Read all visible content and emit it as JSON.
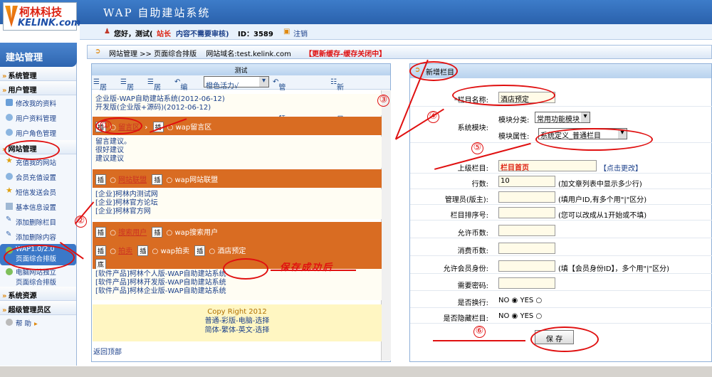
{
  "app": {
    "logo_line1": "柯林科技",
    "logo_line2": "KELINK.com",
    "system_title": "WAP 自助建站系统"
  },
  "user": {
    "greeting": "您好，测试(",
    "role": "站长",
    "notice": "内容不需要审核)",
    "id_label": "ID：3589",
    "logout": "注销"
  },
  "nav": {
    "header": "建站管理",
    "sections": [
      {
        "label": "系统管理"
      },
      {
        "label": "用户管理",
        "items": [
          "修改我的资料",
          "用户资料管理",
          "用户角色管理"
        ]
      },
      {
        "label": "网站管理",
        "items": [
          "充值我的网站",
          "会员充值设置",
          "短信发送会员",
          "基本信息设置",
          "添加删除栏目",
          "添加删除内容",
          "WAP1.0/2.0",
          "页面综合排版",
          "电脑网站独立",
          "页面综合排版"
        ]
      },
      {
        "label": "系统资源"
      },
      {
        "label": "超级管理员区"
      }
    ],
    "help": "帮 助"
  },
  "crumb": {
    "path": "网站管理 >> 页面综合排版",
    "domain_label": "网站域名:test.kelink.com",
    "status": "【更新缓存-缓存关闭中】"
  },
  "left": {
    "title": "测试",
    "toolbar": {
      "left": "居左",
      "center": "居中",
      "right": "居右",
      "edit": "编辑",
      "theme": "橙色活力√",
      "css": "管理CSS样式",
      "new_col": "新增栏目"
    },
    "lines": [
      "企业版-WAP自助建站系统(2012-06-12)",
      "开发版(企业版+源码)(2012-06-12)"
    ],
    "ins": "插",
    "bottom": "底",
    "block1": {
      "a": "留言区",
      "b": "wap留言区"
    },
    "block1_list": [
      "留言建议。",
      "很好建议",
      "建议建议"
    ],
    "block2": {
      "a": "网站联盟",
      "b": "wap网站联盟"
    },
    "block2_list": [
      "[企业]柯林内测试网",
      "[企业]柯林官方论坛",
      "[企业]柯林官方网"
    ],
    "block3": {
      "a": "搜索用户",
      "b": "wap搜索用户"
    },
    "block4": {
      "a": "拍卖",
      "b": "wap拍卖",
      "c": "酒店预定"
    },
    "products": [
      "[软件产品]柯林个人版-WAP自助建站系统",
      "[软件产品]柯林开发版-WAP自助建站系统",
      "[软件产品]柯林企业版-WAP自助建站系统"
    ],
    "footer": [
      "Copy Right 2012",
      "普通-彩版-电脑-选择",
      "简体-繁体-英文-选择"
    ],
    "back_top": "返回顶部",
    "annotation": "保存成功后"
  },
  "right": {
    "title": "新增栏目",
    "rows": [
      {
        "label": "*栏目名称:",
        "value": "酒店预定"
      },
      {
        "label": "系统模块:",
        "sub1": "模块分类:",
        "sel1": "常用功能模块",
        "sub2": "模块属性:",
        "sel2": "系统定义_普通栏目"
      },
      {
        "label": "上级栏目:",
        "value": "栏目首页",
        "note": "【点击更改】"
      },
      {
        "label": "行数:",
        "value": "10",
        "note": "(加文章列表中显示多少行)"
      },
      {
        "label": "管理员(版主):",
        "value": "",
        "note": "(填用户ID,有多个用\"|\"区分)"
      },
      {
        "label": "栏目排序号:",
        "value": "",
        "note": "(您可以改成从1开始或不填)"
      },
      {
        "label": "允许币数:",
        "value": ""
      },
      {
        "label": "消费币数:",
        "value": ""
      },
      {
        "label": "允许会员身份:",
        "value": "",
        "note": "(填【会员身份ID】，多个用\"|\"区分)"
      },
      {
        "label": "需要密码:",
        "value": ""
      },
      {
        "label": "是否换行:",
        "no": "NO",
        "yes": "YES"
      },
      {
        "label": "是否隐藏栏目:",
        "no": "NO",
        "yes": "YES"
      }
    ],
    "save": "保 存"
  },
  "markers": [
    "①",
    "②",
    "③",
    "④",
    "⑤",
    "⑥"
  ],
  "colors": {
    "accent": "#2f66b0",
    "orange": "#d96c22",
    "red": "#e01010"
  }
}
